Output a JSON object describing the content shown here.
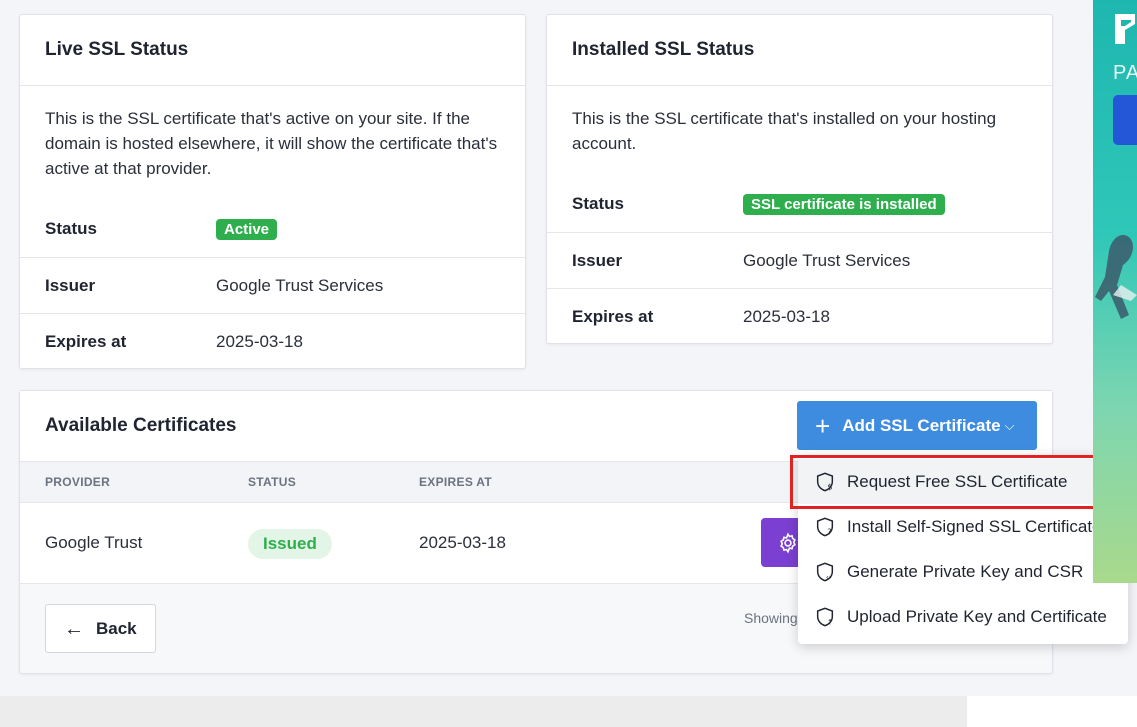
{
  "live": {
    "title": "Live SSL Status",
    "description": "This is the SSL certificate that's active on your site. If the domain is hosted elsewhere, it will show the certificate that's active at that provider.",
    "status_label": "Status",
    "status_value": "Active",
    "issuer_label": "Issuer",
    "issuer_value": "Google Trust Services",
    "expires_label": "Expires at",
    "expires_value": "2025-03-18"
  },
  "installed": {
    "title": "Installed SSL Status",
    "description": "This is the SSL certificate that's installed on your hosting account.",
    "status_label": "Status",
    "status_value": "SSL certificate is installed",
    "issuer_label": "Issuer",
    "issuer_value": "Google Trust Services",
    "expires_label": "Expires at",
    "expires_value": "2025-03-18"
  },
  "available": {
    "title": "Available Certificates",
    "add_button": "Add SSL Certificate",
    "columns": [
      "PROVIDER",
      "STATUS",
      "EXPIRES AT"
    ],
    "rows": [
      {
        "provider": "Google Trust",
        "status": "Issued",
        "expires": "2025-03-18"
      }
    ],
    "back_button": "Back",
    "showing_text": "Showing"
  },
  "dropdown": {
    "items": [
      {
        "label": "Request Free SSL Certificate",
        "icon": "shield-dollar-icon"
      },
      {
        "label": "Install Self-Signed SSL Certificate",
        "icon": "shield-question-icon"
      },
      {
        "label": "Generate Private Key and CSR",
        "icon": "shield-code-icon"
      },
      {
        "label": "Upload Private Key and Certificate",
        "icon": "shield-upload-icon"
      }
    ]
  },
  "ad": {
    "text": "PA"
  },
  "colors": {
    "accent_blue": "#3d8ce0",
    "success_green": "#2fae4e",
    "action_purple": "#7b3fd1",
    "highlight_red": "#e02424"
  }
}
